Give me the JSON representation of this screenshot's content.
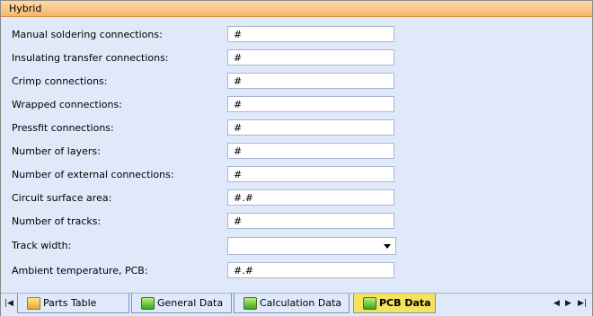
{
  "section_title": "Hybrid",
  "fields": [
    {
      "label": "Manual soldering connections:",
      "value": "#"
    },
    {
      "label": "Insulating transfer connections:",
      "value": "#"
    },
    {
      "label": "Crimp connections:",
      "value": "#"
    },
    {
      "label": "Wrapped connections:",
      "value": "#"
    },
    {
      "label": "Pressfit connections:",
      "value": "#"
    },
    {
      "label": "Number of layers:",
      "value": "#"
    },
    {
      "label": "Number of external connections:",
      "value": "#"
    },
    {
      "label": "Circuit surface area:",
      "value": "#.#"
    },
    {
      "label": "Number of tracks:",
      "value": "#"
    },
    {
      "label": "Track width:",
      "value": ""
    },
    {
      "label": "Ambient temperature, PCB:",
      "value": "#.#"
    }
  ],
  "tabs": [
    {
      "label": "Parts Table",
      "icon": "table-icon",
      "active": false
    },
    {
      "label": "General Data",
      "icon": "sheet-icon",
      "active": false
    },
    {
      "label": "Calculation Data",
      "icon": "sheet-icon",
      "active": false
    },
    {
      "label": "PCB Data",
      "icon": "sheet-icon",
      "active": true
    }
  ],
  "nav": {
    "first": "|◀",
    "prev": "◀",
    "next": "▶",
    "last": "▶|"
  },
  "colors": {
    "header": "#f6b66a",
    "panel": "#dfe9f9",
    "active_tab": "#f5e25f"
  }
}
